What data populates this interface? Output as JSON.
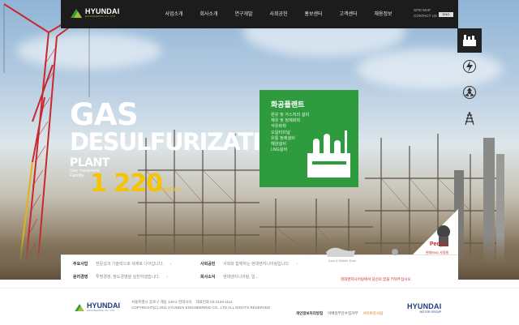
{
  "brand": {
    "name": "HYUNDAI",
    "sub": "ENGINEERING CO.,LTD.",
    "green": "#2f9b3f",
    "yellow": "#f2c500",
    "red": "#c9232a"
  },
  "nav": {
    "items": [
      "사업소개",
      "회사소개",
      "연구개발",
      "사회공헌",
      "홍보센터",
      "고객센터",
      "채용정보"
    ]
  },
  "utility": {
    "sitemap": "SITE MAP",
    "contact": "CONTACT US",
    "lang": "ENG"
  },
  "rail": {
    "icons": [
      "factory-icon",
      "lightning-icon",
      "nuclear-icon",
      "pylon-icon"
    ]
  },
  "hero": {
    "line1": "GAS",
    "line2": "DESULFURIZATION",
    "line3": "PLANT",
    "small1": "Gas Treatment",
    "small2": "Facility",
    "number": "1 220",
    "unit": "MMSCFD"
  },
  "card": {
    "title": "화공플랜트",
    "items": [
      "원유 및 가스처리 설비",
      "제유 및 정제화학",
      "석유화학",
      "오일터미널",
      "유통 정제설비",
      "해양설비",
      "LNG설비"
    ]
  },
  "people": {
    "title": "People",
    "sub": "현대ENG 사람들"
  },
  "panel": {
    "row1_label": "주요사업",
    "row1_text": "전문성과 기술력으로 세계로 나아갑니다.",
    "row1_arrow": "›",
    "row2_label": "윤리경영",
    "row2_text": "투명경영, 정도경영을 실천하겠습니다.",
    "row2_arrow": "›",
    "row3_label": "사회공헌",
    "row3_text": "사회와 함께하는 현대엔지니어링입니다.",
    "row3_arrow": "›",
    "row4_label": "회사소식",
    "row4_text": "현대엔지니어링, 일...",
    "map_label": "Asia & Middle East",
    "promo": "현대엔지니어링에서 당신의 꿈을 키워주십시오."
  },
  "footer": {
    "logo_main": "HYUNDAI",
    "logo_sub": "ENGINEERING CO., LTD.",
    "address": "서울특별시 종로구 계동 140-2 현대사옥",
    "phone": "대표전화 02-2134-1114",
    "copyright": "COPYRIGHT(C) 2011 HYUNDAI ENGINEERING CO., LTD ALL RIGHTS RESERVED",
    "link1": "개인정보처리방침",
    "link2": "이메일무단수집거부",
    "link3": "사이버감사실",
    "group_main": "HYUNDAI",
    "group_sub": "MOTOR GROUP"
  }
}
